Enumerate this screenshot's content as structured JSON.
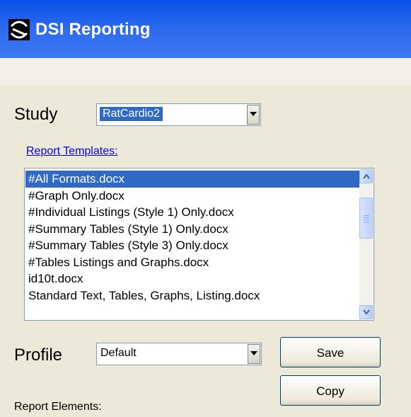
{
  "window": {
    "title": "DSI Reporting",
    "logo_icon": "app-logo-icon"
  },
  "study": {
    "label": "Study",
    "value": "RatCardio2"
  },
  "templates": {
    "link_label": "Report Templates:",
    "items": [
      "#All Formats.docx",
      "#Graph Only.docx",
      "#Individual Listings (Style 1) Only.docx",
      "#Summary Tables (Style 1) Only.docx",
      "#Summary Tables (Style 3) Only.docx",
      "#Tables Listings and Graphs.docx",
      "id10t.docx",
      "Standard Text, Tables, Graphs, Listing.docx"
    ],
    "selected_index": 0
  },
  "profile": {
    "label": "Profile",
    "value": "Default"
  },
  "buttons": {
    "save": "Save",
    "copy": "Copy"
  },
  "report_elements_label": "Report Elements:",
  "colors": {
    "titlebar": "#2f6cf0",
    "selection": "#316ac5",
    "panel": "#ece9d8",
    "link": "#0000ee"
  }
}
